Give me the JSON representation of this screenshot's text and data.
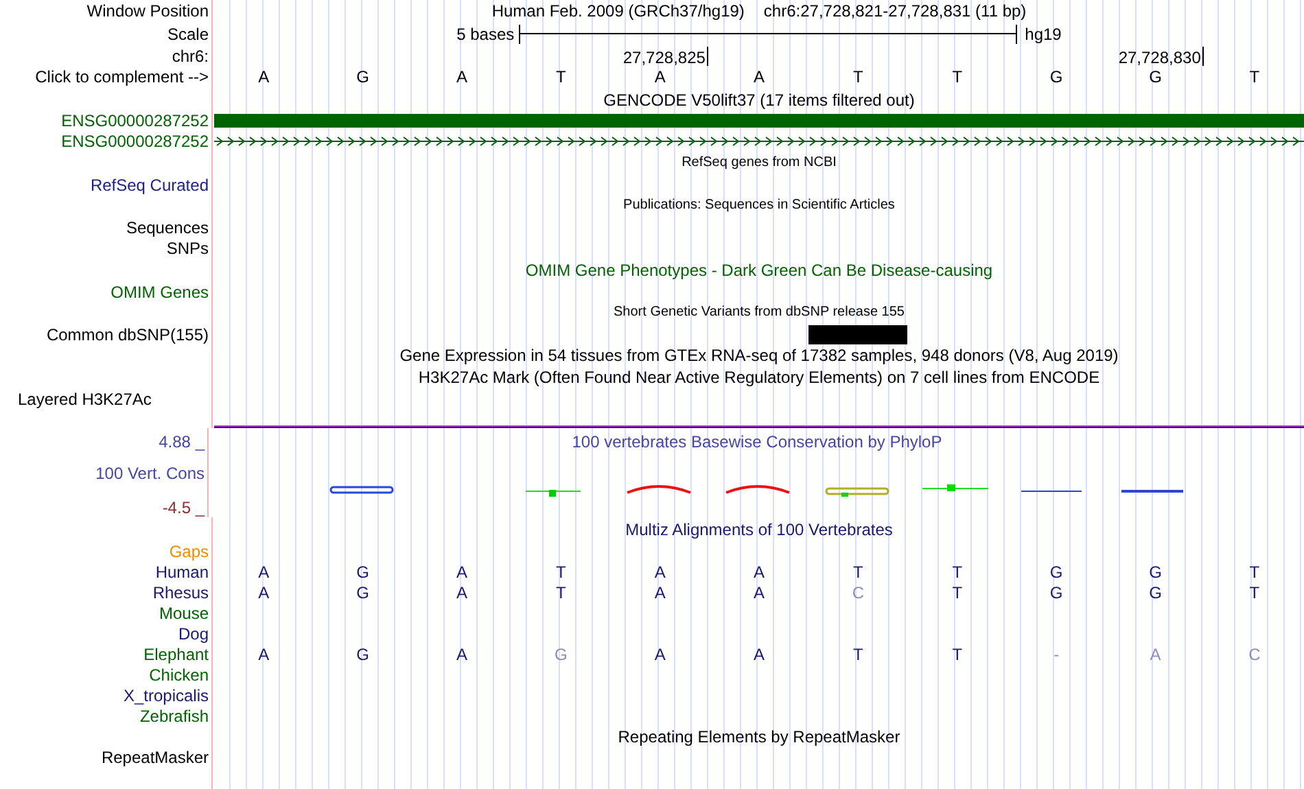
{
  "header": {
    "label": "Window Position",
    "title": "Human Feb. 2009 (GRCh37/hg19)",
    "position": "chr6:27,728,821-27,728,831 (11 bp)"
  },
  "scale": {
    "label": "Scale",
    "span": "5 bases",
    "assembly": "hg19"
  },
  "coordinates": {
    "label": "chr6:",
    "ticks": [
      "27,728,825",
      "27,728,830"
    ]
  },
  "sequence": {
    "label": "Click to complement -->",
    "bases": [
      "A",
      "G",
      "A",
      "T",
      "A",
      "A",
      "T",
      "T",
      "G",
      "G",
      "T"
    ]
  },
  "tracks": [
    {
      "kind": "gene",
      "title": "GENCODE V50lift37 (17 items filtered out)",
      "items": [
        {
          "kind": "block",
          "label": "ENSG00000287252",
          "color": "#006400"
        },
        {
          "kind": "arrows",
          "label": "ENSG00000287252",
          "color": "#006400"
        }
      ]
    },
    {
      "kind": "refseq",
      "title": "RefSeq genes from NCBI",
      "label": "RefSeq Curated",
      "color": "#20208c"
    },
    {
      "kind": "publications",
      "title": "Publications: Sequences in Scientific Articles",
      "labels": [
        "Sequences",
        "SNPs"
      ]
    },
    {
      "kind": "omim",
      "title": "OMIM Gene Phenotypes - Dark Green Can Be Disease-causing",
      "label": "OMIM Genes",
      "color": "#006400"
    },
    {
      "kind": "variants",
      "title": "Short Genetic Variants from dbSNP release 155",
      "label": "Common dbSNP(155)",
      "sites": [
        false,
        false,
        false,
        false,
        false,
        false,
        true,
        false,
        false,
        false,
        false
      ]
    },
    {
      "kind": "expression",
      "title": "Gene Expression in 54 tissues from GTEx RNA-seq of 17382 samples, 948 donors (V8, Aug 2019)"
    },
    {
      "kind": "signal",
      "title": "H3K27Ac Mark (Often Found Near Active Regulatory Elements) on 7 cell lines from ENCODE",
      "label": "Layered H3K27Ac"
    },
    {
      "kind": "conservation",
      "title": "100 vertebrates Basewise Conservation by PhyloP",
      "label": "100 Vert. Cons",
      "ymax": "4.88 _",
      "ymin": "-4.5 _"
    },
    {
      "kind": "alignment",
      "title": "Multiz Alignments of 100 Vertebrates",
      "gaps": "Gaps",
      "species": [
        {
          "name": "Human",
          "color": "#191970",
          "bases": [
            "A",
            "G",
            "A",
            "T",
            "A",
            "A",
            "T",
            "T",
            "G",
            "G",
            "T"
          ]
        },
        {
          "name": "Rhesus",
          "color": "#191970",
          "bases": [
            "A",
            "G",
            "A",
            "T",
            "A",
            "A",
            "C",
            "T",
            "G",
            "G",
            "T"
          ]
        },
        {
          "name": "Mouse",
          "color": "#006400"
        },
        {
          "name": "Dog",
          "color": "#191970"
        },
        {
          "name": "Elephant",
          "color": "#006400",
          "bases": [
            "A",
            "G",
            "A",
            "G",
            "A",
            "A",
            "T",
            "T",
            "-",
            "A",
            "C"
          ]
        },
        {
          "name": "Chicken",
          "color": "#006400"
        },
        {
          "name": "X_tropicalis",
          "color": "#191970"
        },
        {
          "name": "Zebrafish",
          "color": "#006400"
        }
      ]
    },
    {
      "kind": "repeats",
      "title": "Repeating Elements by RepeatMasker",
      "label": "RepeatMasker"
    }
  ]
}
